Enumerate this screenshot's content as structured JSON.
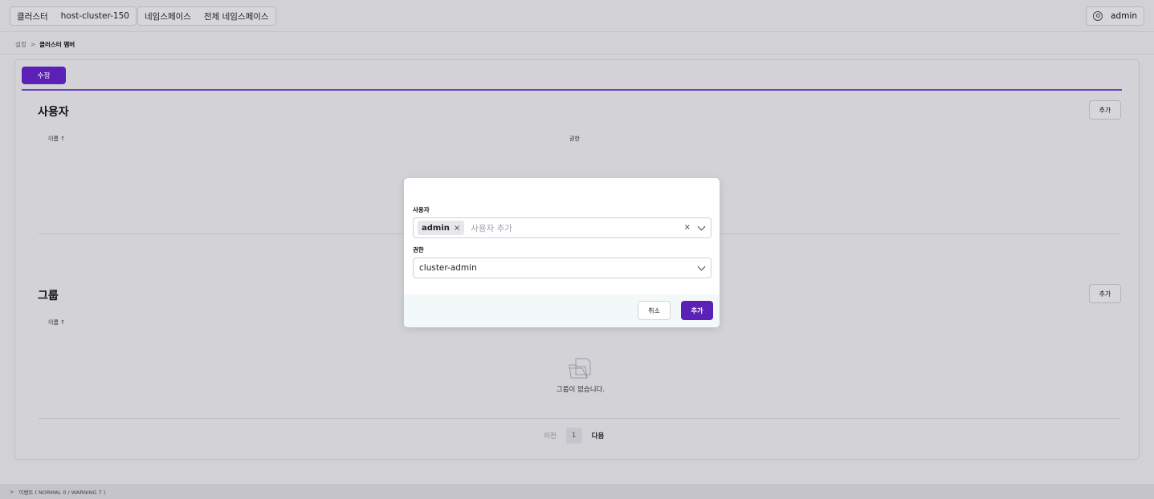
{
  "topbar": {
    "cluster_label": "클러스터",
    "cluster_value": "host-cluster-150",
    "namespace_label": "네임스페이스",
    "namespace_value": "전체 네임스페이스",
    "user_name": "admin"
  },
  "breadcrumb": {
    "parent": "설정",
    "separator": ">",
    "current": "클러스터 멤버"
  },
  "toolbar": {
    "edit_label": "수정"
  },
  "users_section": {
    "title": "사용자",
    "add_label": "추가",
    "columns": [
      "이름 ↑",
      "권한"
    ]
  },
  "groups_section": {
    "title": "그룹",
    "add_label": "추가",
    "columns": [
      "이름 ↑"
    ],
    "empty_text": "그룹이 없습니다."
  },
  "pagination": {
    "prev_label": "이전",
    "current_page": "1",
    "next_label": "다음"
  },
  "eventbar": {
    "toggle": ">",
    "label": "이벤트 ( NORMAL 0 / WARNING 7 )"
  },
  "modal": {
    "user_label": "사용자",
    "selected_user": "admin",
    "tag_remove": "×",
    "user_placeholder": "사용자 추가",
    "clear_icon": "×",
    "role_label": "권한",
    "role_value": "cluster-admin",
    "cancel_label": "취소",
    "confirm_label": "추가"
  },
  "colors": {
    "accent": "#5b21b6",
    "overlay_bg": "#d1d1d6"
  }
}
